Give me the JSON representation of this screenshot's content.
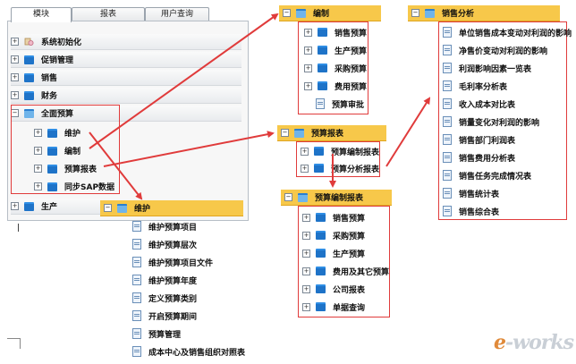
{
  "tabs": [
    {
      "label": "模块"
    },
    {
      "label": "报表"
    },
    {
      "label": "用户查询"
    }
  ],
  "left_tree": {
    "items": [
      {
        "label": "系统初始化"
      },
      {
        "label": "促销管理"
      },
      {
        "label": "销售"
      },
      {
        "label": "财务"
      },
      {
        "label": "全面预算"
      },
      {
        "label": "维护"
      },
      {
        "label": "编制"
      },
      {
        "label": "预算报表"
      },
      {
        "label": "同步SAP数据"
      },
      {
        "label": "生产"
      }
    ]
  },
  "panel_weihu": {
    "title": "维护",
    "items": [
      {
        "label": "维护预算项目"
      },
      {
        "label": "维护预算层次"
      },
      {
        "label": "维护预算项目文件"
      },
      {
        "label": "维护预算年度"
      },
      {
        "label": "定义预算类别"
      },
      {
        "label": "开启预算期间"
      },
      {
        "label": "预算管理"
      },
      {
        "label": "成本中心及销售组织对照表"
      }
    ]
  },
  "panel_bianzhi": {
    "title": "编制",
    "items": [
      {
        "label": "销售预算"
      },
      {
        "label": "生产预算"
      },
      {
        "label": "采购预算"
      },
      {
        "label": "费用预算"
      },
      {
        "label": "预算审批"
      }
    ]
  },
  "panel_yusuan_baobiao": {
    "title": "预算报表",
    "items": [
      {
        "label": "预算编制报表"
      },
      {
        "label": "预算分析报表"
      }
    ]
  },
  "panel_bianzhi_baobiao": {
    "title": "预算编制报表",
    "items": [
      {
        "label": "销售预算"
      },
      {
        "label": "采购预算"
      },
      {
        "label": "生产预算"
      },
      {
        "label": "费用及其它预算"
      },
      {
        "label": "公司报表"
      },
      {
        "label": "单据查询"
      }
    ]
  },
  "panel_xiaoshou_fenxi": {
    "title": "销售分析",
    "items": [
      {
        "label": "单位销售成本变动对利润的影响"
      },
      {
        "label": "净售价变动对利润的影响"
      },
      {
        "label": "利润影响因素一览表"
      },
      {
        "label": "毛利率分析表"
      },
      {
        "label": "收入成本对比表"
      },
      {
        "label": "销量变化对利润的影响"
      },
      {
        "label": "销售部门利润表"
      },
      {
        "label": "销售费用分析表"
      },
      {
        "label": "销售任务完成情况表"
      },
      {
        "label": "销售统计表"
      },
      {
        "label": "销售综合表"
      }
    ]
  },
  "watermark": {
    "prefix": "e",
    "text": "-works"
  },
  "colors": {
    "header_yellow": "#f7c84a",
    "highlight_red": "#e03b3b",
    "folder_blue": "#1e73c8"
  }
}
